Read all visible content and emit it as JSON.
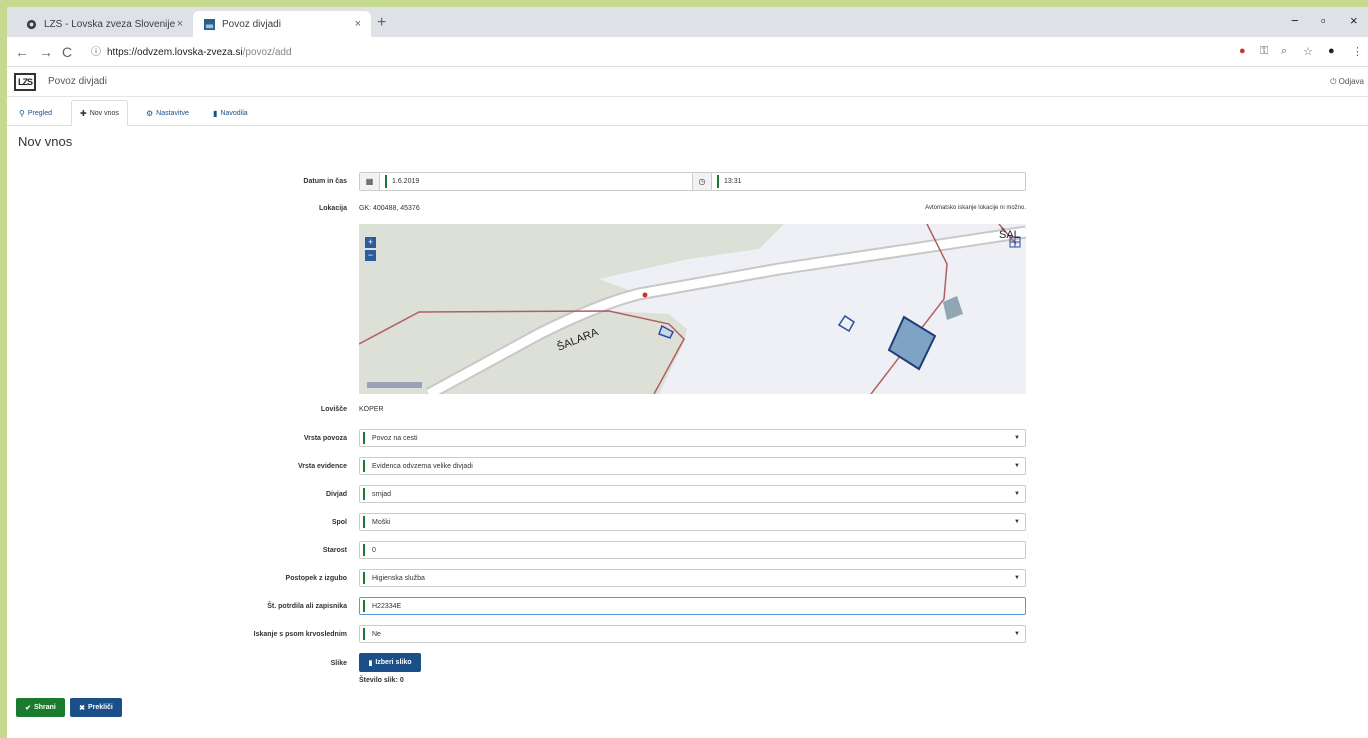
{
  "browser": {
    "tabs": [
      {
        "title": "LZS - Lovska zveza Slovenije",
        "icon": "globe-icon",
        "active": false
      },
      {
        "title": "Povoz divjadi",
        "icon": "image-icon",
        "active": true
      }
    ],
    "url_host": "https://odvzem.lovska-zveza.si",
    "url_path": "/povoz/add"
  },
  "app": {
    "logo_text": "LZS",
    "title": "Povoz divjadi",
    "logout": "Odjava"
  },
  "nav": {
    "tabs": [
      {
        "label": "Pregled",
        "icon": "search-icon"
      },
      {
        "label": "Nov vnos",
        "icon": "plus-icon"
      },
      {
        "label": "Nastavitve",
        "icon": "gear-icon"
      },
      {
        "label": "Navodila",
        "icon": "file-icon"
      }
    ]
  },
  "page": {
    "title": "Nov vnos"
  },
  "form": {
    "datetime_label": "Datum in čas",
    "date_value": "1.6.2019",
    "time_value": "13:31",
    "location_label": "Lokacija",
    "location_value": "GK: 400488, 45376",
    "location_note": "Avtomatsko iskanje lokacije ni možno.",
    "map_road_label": "ŠALARA",
    "map_corner_label": "ŠAL",
    "hunting_ground_label": "Lovišče",
    "hunting_ground_value": "KOPER",
    "type_label": "Vrsta povoza",
    "type_value": "Povoz na cesti",
    "record_label": "Vrsta evidence",
    "record_value": "Evidenca odvzema velike divjadi",
    "game_label": "Divjad",
    "game_value": "srnjad",
    "sex_label": "Spol",
    "sex_value": "Moški",
    "age_label": "Starost",
    "age_value": "0",
    "procedure_label": "Postopek z izgubo",
    "procedure_value": "Higienska služba",
    "cert_label": "Št. potrdila ali zapisnika",
    "cert_value": "H22334E",
    "search_label": "Iskanje s psom krvoslednim",
    "search_value": "Ne",
    "images_label": "Slike",
    "add_image": "Izberi sliko",
    "image_count": "Število slik: 0"
  },
  "actions": {
    "save": "Shrani",
    "cancel": "Prekliči"
  },
  "colors": {
    "page_bg": "#c5d98f",
    "primary": "#1a4f8a",
    "success": "#1a7a2e"
  }
}
